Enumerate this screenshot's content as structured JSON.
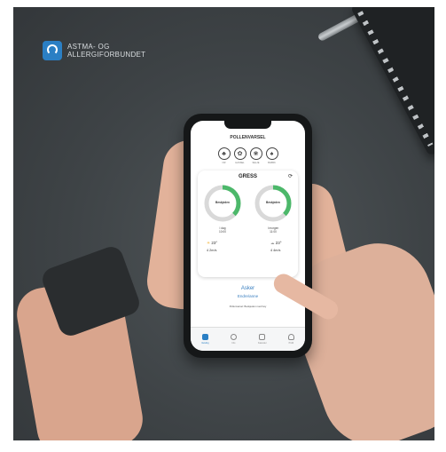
{
  "logo": {
    "line1": "ASTMA- OG",
    "line2": "ALLERGIFORBUNDET"
  },
  "app": {
    "title": "POLLENVARSEL",
    "pollen_types": [
      {
        "icon": "alder-icon",
        "glyph": "♣",
        "label": "OR"
      },
      {
        "icon": "hazel-icon",
        "glyph": "✿",
        "label": "HASSEL"
      },
      {
        "icon": "willow-icon",
        "glyph": "❀",
        "label": "SELJE"
      },
      {
        "icon": "birch-icon",
        "glyph": "♠",
        "label": "BJØRK"
      }
    ],
    "card": {
      "title": "GRESS",
      "today": {
        "level": "Beskjeden",
        "day": "I dag",
        "time": "10:00",
        "temp": "23°",
        "wind": "4 2m/s"
      },
      "tomorrow": {
        "level": "Beskjeden",
        "day": "I morgen",
        "time": "11:00",
        "temp": "23°",
        "wind": "4 4m/s"
      }
    },
    "location": "Asker",
    "location_sub": "Endre/anne",
    "note": "Pollenvarsel: Beskjeden med høy",
    "tabs": [
      {
        "label": "Varsling",
        "active": true
      },
      {
        "label": "Info",
        "active": false
      },
      {
        "label": "Kalender",
        "active": false
      },
      {
        "label": "Profil",
        "active": false
      }
    ],
    "accent": "#2b7fc4",
    "ring_green": "#4cb86a"
  }
}
